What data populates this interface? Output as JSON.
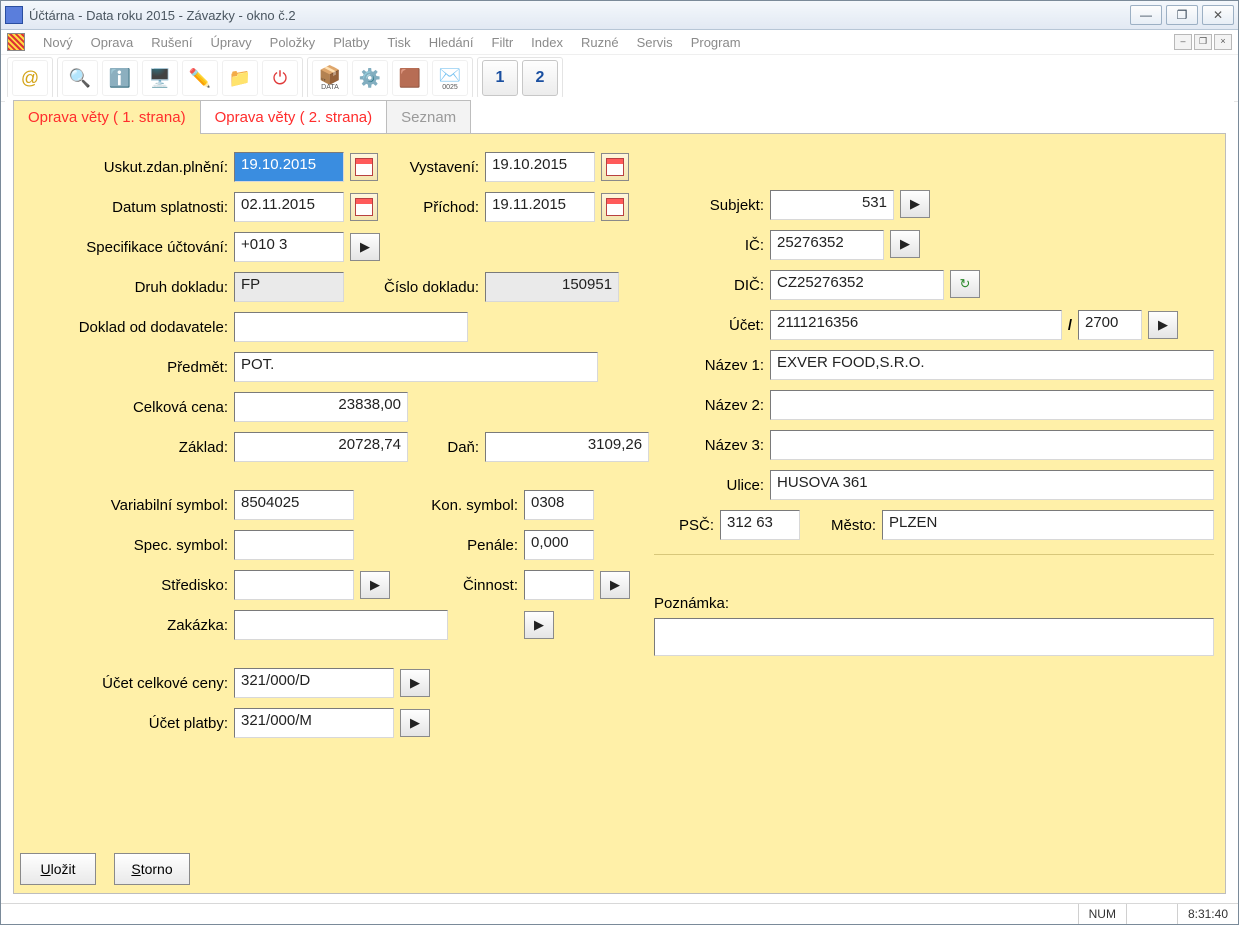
{
  "title": "Účtárna - Data roku 2015 - Závazky - okno č.2",
  "menu": [
    "Nový",
    "Oprava",
    "Rušení",
    "Úpravy",
    "Položky",
    "Platby",
    "Tisk",
    "Hledání",
    "Filtr",
    "Index",
    "Ruzné",
    "Servis",
    "Program"
  ],
  "toolbar": {
    "data_label": "DATA",
    "mail_label": "0025",
    "num1": "1",
    "num2": "2"
  },
  "tabs": {
    "t1": "Oprava věty ( 1. strana)",
    "t2": "Oprava věty ( 2. strana)",
    "t3": "Seznam"
  },
  "labels": {
    "uskut": "Uskut.zdan.plnění:",
    "vystaveni": "Vystavení:",
    "splatnost": "Datum splatnosti:",
    "prichod": "Příchod:",
    "spec_uct": "Specifikace účtování:",
    "druh": "Druh dokladu:",
    "cislo": "Číslo dokladu:",
    "doklad_dod": "Doklad od dodavatele:",
    "predmet": "Předmět:",
    "celkova": "Celková cena:",
    "zaklad": "Základ:",
    "dan": "Daň:",
    "varsym": "Variabilní symbol:",
    "konsym": "Kon. symbol:",
    "specsym": "Spec. symbol:",
    "penale": "Penále:",
    "stredisko": "Středisko:",
    "cinnost": "Činnost:",
    "zakazka": "Zakázka:",
    "ucet_celk": "Účet celkové ceny:",
    "ucet_plat": "Účet platby:",
    "subjekt": "Subjekt:",
    "ic": "IČ:",
    "dic": "DIČ:",
    "ucet": "Účet:",
    "slash": "/",
    "nazev1": "Název 1:",
    "nazev2": "Název 2:",
    "nazev3": "Název 3:",
    "ulice": "Ulice:",
    "psc": "PSČ:",
    "mesto": "Město:",
    "poznamka": "Poznámka:"
  },
  "values": {
    "uskut": "19.10.2015",
    "vystaveni": "19.10.2015",
    "splatnost": "02.11.2015",
    "prichod": "19.11.2015",
    "spec_uct": "+010 3",
    "druh": "FP",
    "cislo": "150951",
    "doklad_dod": "",
    "predmet": "POT.",
    "celkova": "23838,00",
    "zaklad": "20728,74",
    "dan": "3109,26",
    "varsym": "8504025",
    "konsym": "0308",
    "specsym": "",
    "penale": "0,000",
    "stredisko": "",
    "cinnost": "",
    "zakazka": "",
    "ucet_celk": "321/000/D",
    "ucet_plat": "321/000/M",
    "subjekt": "531",
    "ic": "25276352",
    "dic": "CZ25276352",
    "ucet": "2111216356",
    "ucet2": "2700",
    "nazev1": "EXVER FOOD,S.R.O.",
    "nazev2": "",
    "nazev3": "",
    "ulice": "HUSOVA 361",
    "psc": "312 63",
    "mesto": "PLZEN",
    "poznamka": ""
  },
  "buttons": {
    "play": "▶",
    "ulozit_u": "U",
    "ulozit_rest": "ložit",
    "storno_u": "S",
    "storno_rest": "torno"
  },
  "status": {
    "num": "NUM",
    "time": "8:31:40"
  }
}
